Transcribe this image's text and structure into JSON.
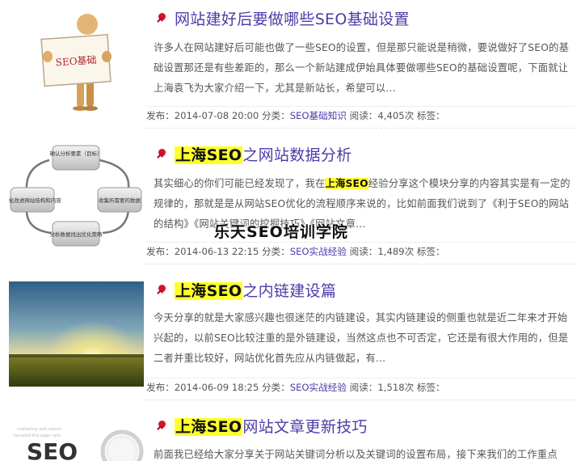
{
  "posts": [
    {
      "title_prefix": "",
      "title_rest": "网站建好后要做哪些SEO基础设置",
      "excerpt_pre": "许多人在网站建好后可能也做了一些SEO的设置，但是那只能说是稍微，要说做好了SEO的基础设置那还是有些差距的，那么一个新站建成伊始具体要做哪些SEO的基础设置呢，下面就让上海袁飞为大家介绍一下，尤其是新站长，希望可以...",
      "excerpt_kw": "",
      "excerpt_post": "",
      "meta_prefix": "发布：2014-07-08 20:00 分类：",
      "category": "SEO基础知识",
      "meta_suffix": " 阅读：4,405次 标签：",
      "thumb_label": "SEO基础"
    },
    {
      "title_prefix": "上海SEO",
      "title_rest": "之网站数据分析",
      "excerpt_pre": "其实细心的你们可能已经发现了，我在",
      "excerpt_kw": "上海SEO",
      "excerpt_post": "经验分享这个模块分享的内容其实是有一定的规律的，那就是是从网站SEO优化的流程顺序来说的，比如前面我们说到了《利于SEO的网站的结构》《网站关键词的挖掘技巧》《网站文章...",
      "meta_prefix": "发布：2014-06-13 22:15 分类：",
      "category": "SEO实战经验",
      "meta_suffix": " 阅读：1,489次 标签：",
      "diagram_nodes": [
        "确认分析要素（目标）",
        "收集所需要的数据",
        "分析数据找出优化策略",
        "优化改进网站结构和内容"
      ]
    },
    {
      "title_prefix": "上海SEO",
      "title_rest": "之内链建设篇",
      "excerpt_pre": "今天分享的就是大家感兴趣也很迷茫的内链建设，其实内链建设的侧重也就是近二年来才开始兴起的，以前SEO比较注重的是外链建设，当然这点也不可否定，它还是有很大作用的，但是二者并重比较好，网站优化首先应从内链做起，有...",
      "excerpt_kw": "",
      "excerpt_post": "",
      "meta_prefix": "发布：2014-06-09 18:25 分类：",
      "category": "SEO实战经验",
      "meta_suffix": " 阅读：1,518次 标签："
    },
    {
      "title_prefix": "上海SEO",
      "title_rest": "网站文章更新技巧",
      "excerpt_pre": "前面我已经给大家分享关于网站关键词分析以及关键词的设置布局，接下来我们的工作重点",
      "excerpt_kw": "",
      "excerpt_post": "",
      "thumb_label": "SEO"
    }
  ],
  "watermark": "乐天SEO培训学院",
  "colors": {
    "title": "#4f3aa8",
    "highlight": "#ffff2a",
    "pin": "#d4142a"
  }
}
